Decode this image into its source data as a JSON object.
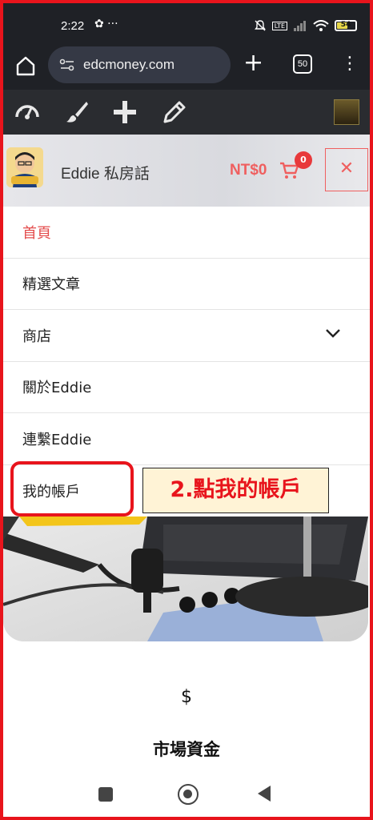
{
  "status_bar": {
    "time": "2:22",
    "left_icons": "✿ ···",
    "battery": "54",
    "network": "LTE",
    "colors": {
      "background": "#1f2126",
      "battery_fill": "#e8d84a"
    }
  },
  "browser": {
    "url": "edcmoney.com",
    "tab_count": "50",
    "icons": [
      "home-icon",
      "site-settings-icon",
      "plus-icon",
      "tabs-icon",
      "more-vert-icon"
    ]
  },
  "admin_toolbar": {
    "icons": [
      "dashboard-icon",
      "customize-brush-icon",
      "add-new-icon",
      "edit-pencil-icon",
      "user-avatar"
    ]
  },
  "site_header": {
    "title": "Eddie 私房話",
    "cart_price": "NT$0",
    "cart_count": "0",
    "close_label": "✕",
    "colors": {
      "accent": "#ef5f5f",
      "badge": "#e8393b"
    }
  },
  "menu": {
    "items": [
      {
        "label": "首頁",
        "active": true
      },
      {
        "label": "精選文章",
        "active": false
      },
      {
        "label": "商店",
        "active": false,
        "has_submenu": true
      },
      {
        "label": "關於Eddie",
        "active": false
      },
      {
        "label": "連繫Eddie",
        "active": false
      },
      {
        "label": "我的帳戶",
        "active": false
      }
    ],
    "active_color": "#e44c4c"
  },
  "annotation": {
    "label": "2.點我的帳戶",
    "colors": {
      "border": "#e8141c",
      "label_bg": "#fff3d6"
    }
  },
  "content": {
    "dollar_symbol": "$",
    "section_title": "市場資金"
  },
  "android_nav": {
    "icons": [
      "recents-square-icon",
      "home-circle-icon",
      "back-triangle-icon"
    ]
  }
}
